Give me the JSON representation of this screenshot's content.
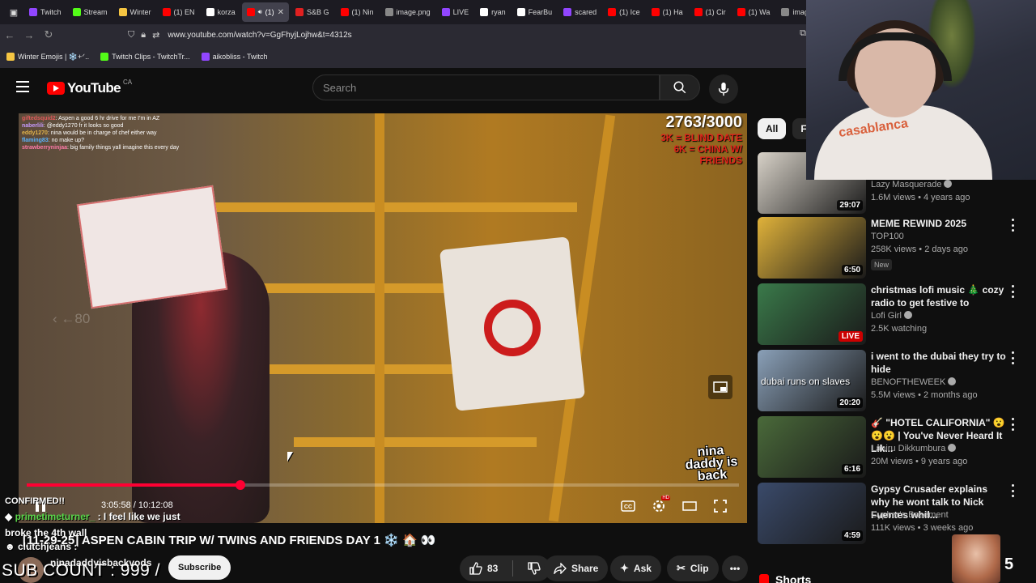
{
  "browser": {
    "tabs": [
      {
        "label": "Twitch",
        "color": "#9146ff"
      },
      {
        "label": "Stream",
        "color": "#53fc18"
      },
      {
        "label": "Winter",
        "color": "#f5c542"
      },
      {
        "label": "(1) EN",
        "color": "#ff0000"
      },
      {
        "label": "korza",
        "color": "#ffffff"
      },
      {
        "label": "(1)",
        "color": "#ff0000",
        "active": true
      },
      {
        "label": "S&B G",
        "color": "#e02020"
      },
      {
        "label": "(1) Nin",
        "color": "#ff0000"
      },
      {
        "label": "image.png",
        "color": "#888888"
      },
      {
        "label": "LIVE",
        "color": "#9146ff"
      },
      {
        "label": "ryan",
        "color": "#ffffff"
      },
      {
        "label": "FearBu",
        "color": "#ffffff"
      },
      {
        "label": "scared",
        "color": "#9146ff"
      },
      {
        "label": "(1) Ice",
        "color": "#ff0000"
      },
      {
        "label": "(1) Ha",
        "color": "#ff0000"
      },
      {
        "label": "(1) Cir",
        "color": "#ff0000"
      },
      {
        "label": "(1) Wa",
        "color": "#ff0000"
      },
      {
        "label": "image.png",
        "color": "#888888"
      }
    ],
    "url": "www.youtube.com/watch?v=GgFhyjLojhw&t=4312s",
    "bookmarks": [
      {
        "label": "Winter Emojis | ❄️+ᐟ..",
        "color": "#f5c542"
      },
      {
        "label": "Twitch Clips - TwitchTr...",
        "color": "#53fc18"
      },
      {
        "label": "aikobliss - Twitch",
        "color": "#9146ff"
      }
    ]
  },
  "header": {
    "logo_text": "YouTube",
    "country": "CA",
    "search_placeholder": "Search"
  },
  "player": {
    "chat_lines": [
      {
        "user": "giftedsquid2",
        "text": ": Aspen a good 6 hr drive for me I'm in AZ",
        "color": "#e05a5a"
      },
      {
        "user": "naberlili",
        "text": ": @eddy1270 fr it looks so good",
        "color": "#c79bff"
      },
      {
        "user": "eddy1270",
        "text": ": nina would be in charge of chef either way",
        "color": "#e0b24a"
      },
      {
        "user": "flaming83",
        "text": ": no make up?",
        "color": "#5ab4ff"
      },
      {
        "user": "strawberryninjaa",
        "text": ": big family things yall imagine this every day",
        "color": "#ff7aa8"
      }
    ],
    "goal_count": "2763/3000",
    "goal_lines": [
      "3K = BLIND DATE",
      "6K = CHINA W/",
      "FRIENDS"
    ],
    "skip_label": "80",
    "sticker_text": "nina daddy is back",
    "progress": 0.3,
    "current_time": "3:05:58",
    "duration": "10:12:08",
    "time_separator": " / ",
    "settings_badge": "HD"
  },
  "stream_overlay": {
    "confirmed": "CONFIRMED!!",
    "chat_user": "primetimeturner_",
    "chat_text": " : I feel like we just",
    "wall_text": "broke the 4th wall",
    "clutch_user": "clutchjeans",
    "sub_count": "SUB COUNT : 999 /"
  },
  "video": {
    "title": "[11-29-25] ASPEN CABIN TRIP W/ TWINS AND FRIENDS DAY 1 ❄️ 🏠 👀",
    "channel": "ninadaddyisbackvods",
    "subscribe_label": "Subscribe",
    "likes": "83",
    "share_label": "Share",
    "ask_label": "Ask",
    "clip_label": "Clip"
  },
  "chips": [
    "All",
    "Fr"
  ],
  "recommendations": [
    {
      "title": "",
      "channel": "Lazy Masquerade",
      "verified": true,
      "meta": "1.6M views • 4 years ago",
      "duration": "29:07",
      "thumb_color": "#d8d2c8",
      "thumb_text": ""
    },
    {
      "title": "MEME REWIND 2025",
      "channel": "TOP100",
      "verified": false,
      "meta": "258K views • 2 days ago",
      "badge": "New",
      "duration": "6:50",
      "thumb_color": "#e0b23a",
      "thumb_text": ""
    },
    {
      "title": "christmas lofi music 🎄 cozy radio to get festive to",
      "channel": "Lofi Girl",
      "verified": true,
      "meta": "2.5K watching",
      "live": "LIVE",
      "thumb_color": "#3a7a4a",
      "thumb_text": ""
    },
    {
      "title": "i went to the dubai they try to hide",
      "channel": "BENOFTHEWEEK",
      "verified": true,
      "meta": "5.5M views • 2 months ago",
      "duration": "20:20",
      "thumb_color": "#8aa0b8",
      "thumb_text": "dubai runs on slaves"
    },
    {
      "title": "🎸 \"HOTEL CALIFORNIA\" 😮😮😮 | You've Never Heard It Lik...",
      "channel": "Lahiru Dikkumbura",
      "verified": true,
      "meta": "20M views • 9 years ago",
      "duration": "6:16",
      "thumb_color": "#4a6a3a",
      "thumb_text": ""
    },
    {
      "title": "Gypsy Crusader explains why he wont talk to Nick Fuentes whil...",
      "channel": "Cypher's Basement",
      "verified": false,
      "meta": "111K views • 3 weeks ago",
      "duration": "4:59",
      "thumb_color": "#3a4a6a",
      "thumb_text": ""
    }
  ],
  "shorts_label": "Shorts",
  "webcam": {
    "sweater_text": "casablanca"
  },
  "corner_count": "5"
}
